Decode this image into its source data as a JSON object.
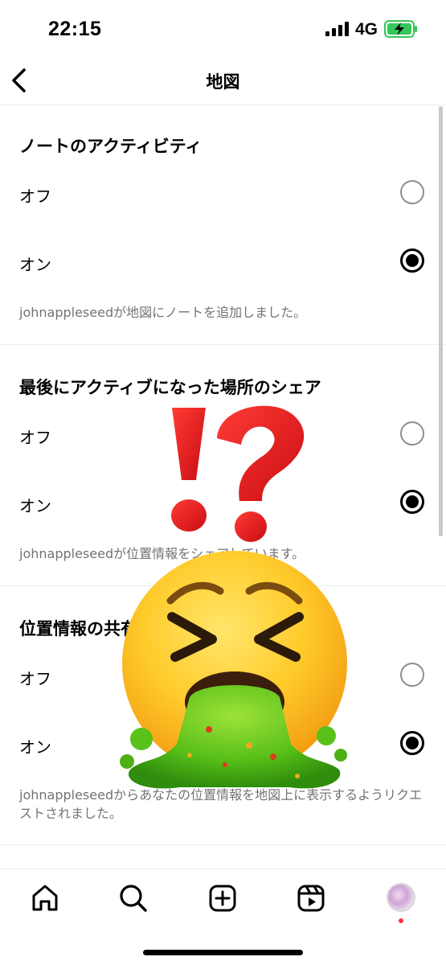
{
  "status_bar": {
    "time": "22:15",
    "network": "4G",
    "signal_icon": "cellular-signal-icon",
    "battery_icon": "battery-charging-icon",
    "battery_color": "#34c759"
  },
  "header": {
    "title": "地図",
    "back_icon": "chevron-left-icon"
  },
  "sections": [
    {
      "title": "ノートのアクティビティ",
      "options": [
        {
          "label": "オフ",
          "selected": false
        },
        {
          "label": "オン",
          "selected": true
        }
      ],
      "helper": "johnappleseedが地図にノートを追加しました。"
    },
    {
      "title": "最後にアクティブになった場所のシェア",
      "options": [
        {
          "label": "オフ",
          "selected": false
        },
        {
          "label": "オン",
          "selected": true
        }
      ],
      "helper": "johnappleseedが位置情報をシェアしています。"
    },
    {
      "title": "位置情報の共有",
      "options": [
        {
          "label": "オフ",
          "selected": false
        },
        {
          "label": "オン",
          "selected": true
        }
      ],
      "helper": "johnappleseedからあなたの位置情報を地図上に表示するようリクエストされました。"
    }
  ],
  "overlay": {
    "sticker_icons": [
      "exclamation-question-mark-icon",
      "vomiting-face-icon"
    ]
  },
  "bottom_nav": {
    "items": [
      "home-icon",
      "search-icon",
      "create-post-icon",
      "reels-icon",
      "profile-avatar"
    ],
    "notification_dot_color": "#ff3040"
  },
  "colors": {
    "selected_radio": "#000000",
    "unselected_radio": "#8e8e8e",
    "helper_text": "#737373"
  }
}
